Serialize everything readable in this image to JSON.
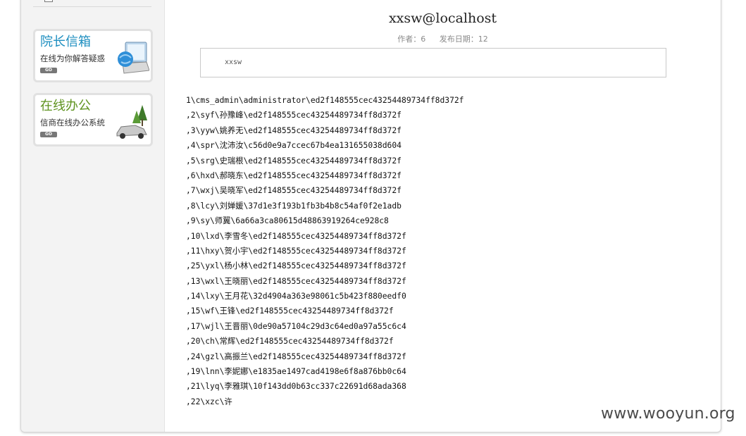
{
  "sidebar": {
    "promos": [
      {
        "title": "院长信箱",
        "subtitle": "在线为你解答疑惑",
        "go_label": "GO"
      },
      {
        "title": "在线办公",
        "subtitle": "信商在线办公系统",
        "go_label": "GO"
      }
    ]
  },
  "post": {
    "title": "xxsw@localhost",
    "author_label": "作者：6",
    "date_label": "发布日期：12",
    "box_text": "xxsw"
  },
  "dump_lines": [
    "1\\cms_admin\\administrator\\ed2f148555cec43254489734ff8d372f",
    ",2\\syf\\孙豫峰\\ed2f148555cec43254489734ff8d372f",
    ",3\\yyw\\姚养无\\ed2f148555cec43254489734ff8d372f",
    ",4\\spr\\沈沛汝\\c56d0e9a7ccec67b4ea131655038d604",
    ",5\\srg\\史瑞根\\ed2f148555cec43254489734ff8d372f",
    ",6\\hxd\\郝晓东\\ed2f148555cec43254489734ff8d372f",
    ",7\\wxj\\吴晓军\\ed2f148555cec43254489734ff8d372f",
    ",8\\lcy\\刘婵媛\\37d1e3f193b1fb3b4b8c54af0f2e1adb",
    ",9\\sy\\师翼\\6a66a3ca80615d48863919264ce928c8",
    ",10\\lxd\\李雪冬\\ed2f148555cec43254489734ff8d372f",
    ",11\\hxy\\贺小宇\\ed2f148555cec43254489734ff8d372f",
    ",25\\yxl\\杨小林\\ed2f148555cec43254489734ff8d372f",
    ",13\\wxl\\王晓丽\\ed2f148555cec43254489734ff8d372f",
    ",14\\lxy\\王月花\\32d4904a363e98061c5b423f880eedf0",
    ",15\\wf\\王锋\\ed2f148555cec43254489734ff8d372f",
    ",17\\wjl\\王晋丽\\0de90a57104c29d3c64ed0a97a55c6c4",
    ",20\\ch\\常辉\\ed2f148555cec43254489734ff8d372f",
    ",24\\gzl\\高振兰\\ed2f148555cec43254489734ff8d372f",
    ",19\\lnn\\李妮娜\\e1835ae1497cad4198e6f8a876bb0c64",
    ",21\\lyq\\李雅琪\\10f143dd0b63cc337c22691d68ada368",
    ",22\\xzc\\许"
  ],
  "watermark": "www.wooyun.org"
}
